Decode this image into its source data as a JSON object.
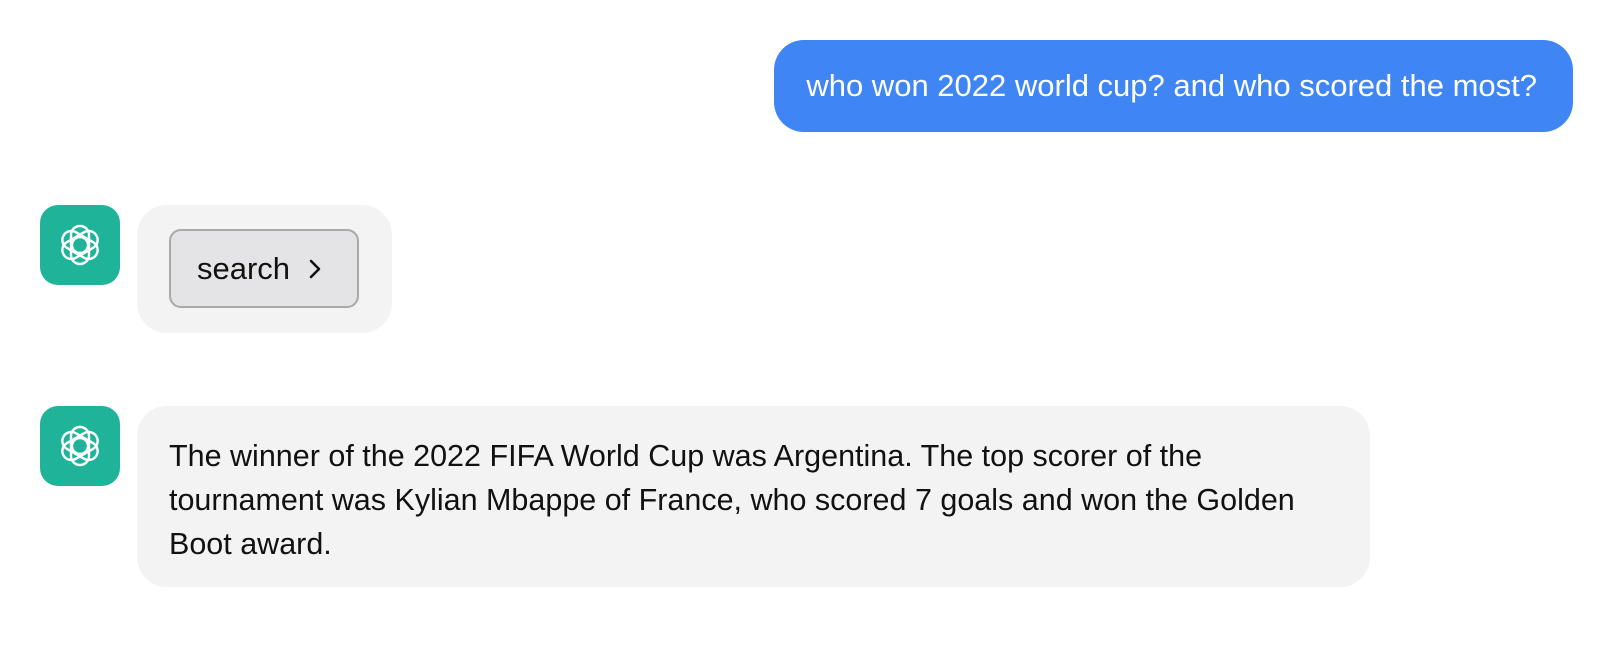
{
  "conversation": {
    "user_message": "who won 2022 world cup? and who scored the most?",
    "assistant_avatar_icon": "openai-logo-icon",
    "tool_call": {
      "label": "search",
      "icon": "chevron-right-icon"
    },
    "assistant_message": "The winner of the 2022 FIFA World Cup was Argentina. The top scorer of the tournament was Kylian Mbappe of France, who scored 7 goals and won the Golden Boot award."
  },
  "colors": {
    "user_bubble": "#3f85f4",
    "assistant_bubble": "#f3f3f3",
    "avatar_bg": "#1fb49a",
    "search_button_bg": "#e4e4e6"
  }
}
